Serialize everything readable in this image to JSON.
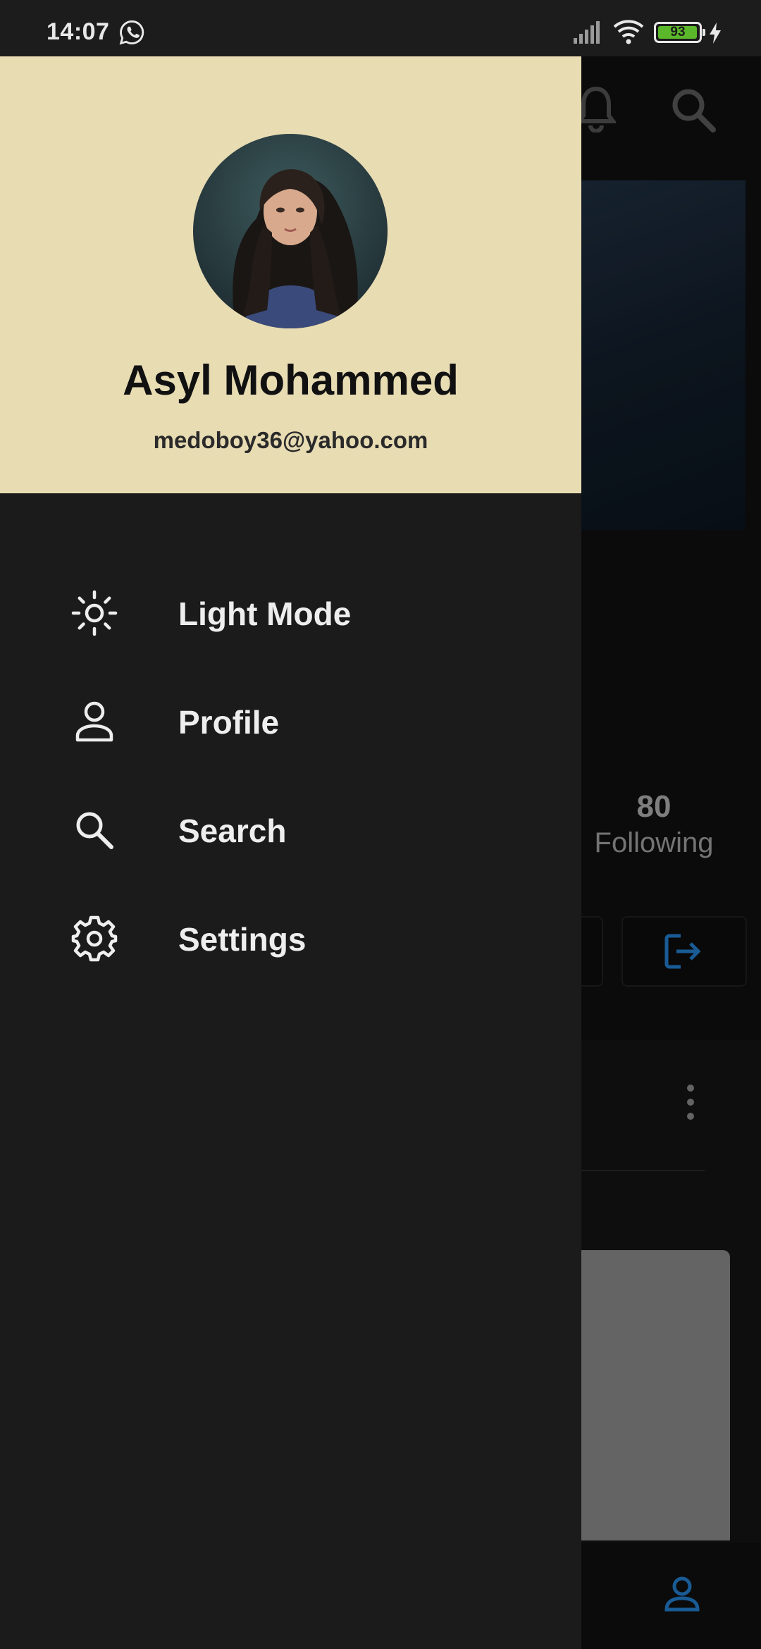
{
  "status_bar": {
    "time": "14:07",
    "battery_level": "93",
    "icons": [
      "whatsapp-icon",
      "signal-icon",
      "wifi-icon",
      "battery-icon",
      "charging-icon"
    ]
  },
  "drawer": {
    "user_name": "Asyl Mohammed",
    "user_email": "medoboy36@yahoo.com",
    "menu": [
      {
        "label": "Light Mode",
        "icon": "sun-icon"
      },
      {
        "label": "Profile",
        "icon": "person-icon"
      },
      {
        "label": "Search",
        "icon": "search-icon"
      },
      {
        "label": "Settings",
        "icon": "gear-icon"
      }
    ]
  },
  "background_screen": {
    "following_count": "80",
    "following_label": "Following",
    "icons": [
      "notification-bell-icon",
      "search-icon",
      "logout-icon",
      "more-vertical-icon",
      "profile-nav-icon"
    ]
  },
  "colors": {
    "drawer_header_bg": "#e8dcb3",
    "drawer_bg": "#1b1b1b",
    "accent_blue": "#1f6fb6",
    "battery_green": "#5cb82b"
  }
}
